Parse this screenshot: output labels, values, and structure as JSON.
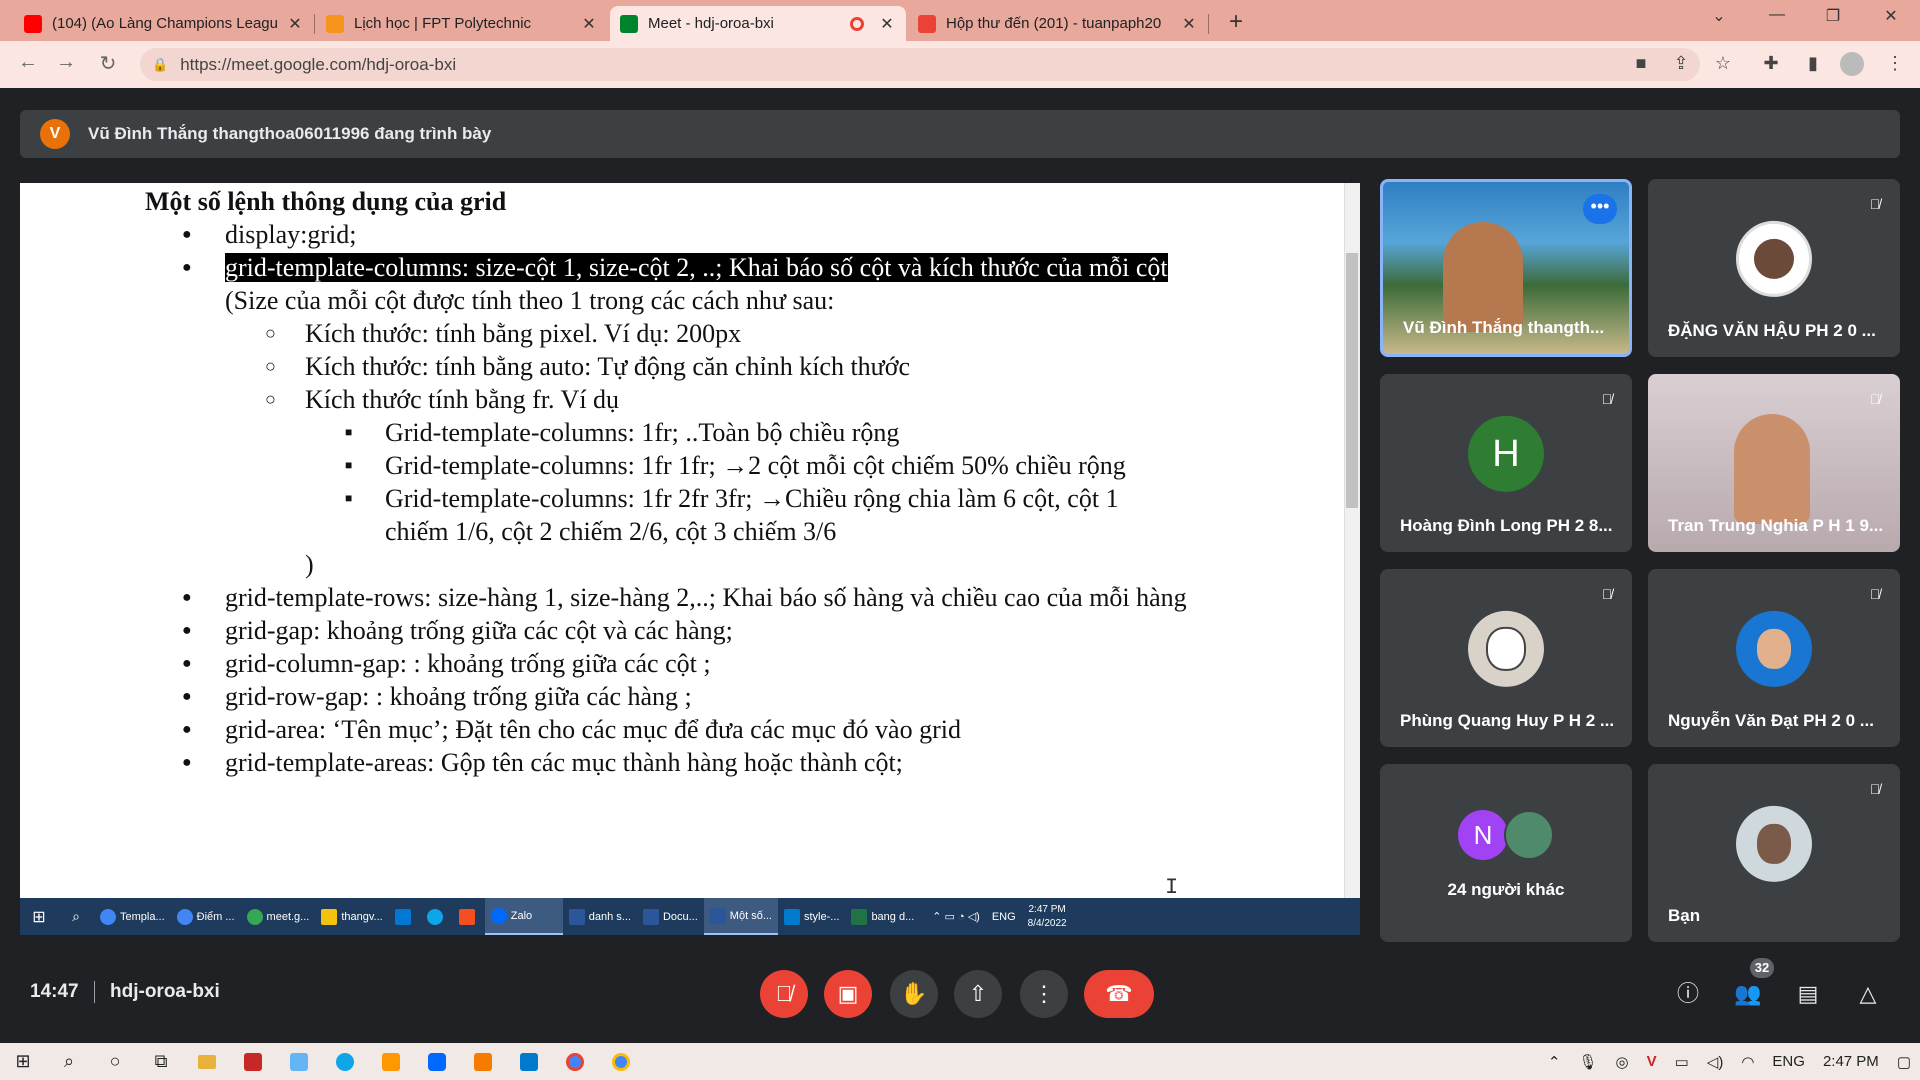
{
  "tabs": [
    {
      "title": "(104) (Ao Làng Champions Leagu",
      "color": "#ff0000"
    },
    {
      "title": "Lịch học | FPT Polytechnic",
      "color": "#f7941d"
    },
    {
      "title": "Meet - hdj-oroa-bxi",
      "color": "#00832d"
    },
    {
      "title": "Hộp thư đến (201) - tuanpaph20",
      "color": "#ea4335"
    }
  ],
  "url": "https://meet.google.com/hdj-oroa-bxi",
  "presenter": {
    "initial": "V",
    "text": "Vũ Đình Thắng thangthoa06011996 đang trình bày"
  },
  "doc": {
    "heading": "Một số lệnh thông dụng của grid",
    "b1": "display:grid;",
    "b2": "grid-template-columns: size-cột 1, size-cột 2, ..; Khai báo số cột và kích thước của mỗi cột",
    "p1": "(Size của mỗi cột được tính theo 1 trong các cách như sau:",
    "s1": "Kích thước: tính bằng pixel. Ví dụ: 200px",
    "s2": "Kích thước: tính bằng auto: Tự động căn chỉnh kích thước",
    "s3": "Kích thước tính bằng fr. Ví dụ",
    "t1": "Grid-template-columns: 1fr;  ..Toàn bộ chiều rộng",
    "t2": "Grid-template-columns: 1fr 1fr; →2 cột mỗi cột chiếm 50% chiều rộng",
    "t3": "Grid-template-columns: 1fr 2fr 3fr; →Chiều rộng chia làm 6 cột, cột 1 chiếm 1/6, cột 2 chiếm 2/6, cột 3 chiếm 3/6",
    "close": ")",
    "b3": "grid-template-rows: size-hàng 1, size-hàng 2,..; Khai báo số hàng và chiều cao của mỗi hàng",
    "b4": "grid-gap: khoảng trống giữa các cột và các hàng;",
    "b5": "grid-column-gap: : khoảng trống giữa các cột ;",
    "b6": "grid-row-gap: : khoảng trống giữa các hàng ;",
    "b7": "grid-area: ‘Tên mục’;  Đặt tên cho các mục để đưa các mục đó vào grid",
    "b8": "grid-template-areas: Gộp tên các mục thành hàng hoặc thành cột;"
  },
  "shared_taskbar": {
    "items": [
      "Templa...",
      "Điểm ...",
      "meet.g...",
      "thangv...",
      "Zalo",
      "danh s...",
      "Docu...",
      "Một số...",
      "style-...",
      "bang d..."
    ],
    "lang": "ENG",
    "time": "2:47 PM",
    "date": "8/4/2022"
  },
  "participants": [
    {
      "name": "Vũ Đình Thắng thangth...",
      "initial": ""
    },
    {
      "name": "ĐẶNG VĂN HẬU PH 2 0 ...",
      "initial": ""
    },
    {
      "name": "Hoàng Đình Long PH 2 8...",
      "initial": "H"
    },
    {
      "name": "Tran Trung Nghia P H 1 9...",
      "initial": ""
    },
    {
      "name": "Phùng Quang Huy P H 2 ...",
      "initial": ""
    },
    {
      "name": "Nguyễn Văn Đạt PH 2 0 ...",
      "initial": ""
    },
    {
      "name": "24 người khác",
      "initial": "N"
    },
    {
      "name": "Bạn",
      "initial": ""
    }
  ],
  "meeting": {
    "time": "14:47",
    "code": "hdj-oroa-bxi",
    "people_count": "32"
  },
  "os": {
    "lang": "ENG",
    "time": "2:47 PM"
  }
}
